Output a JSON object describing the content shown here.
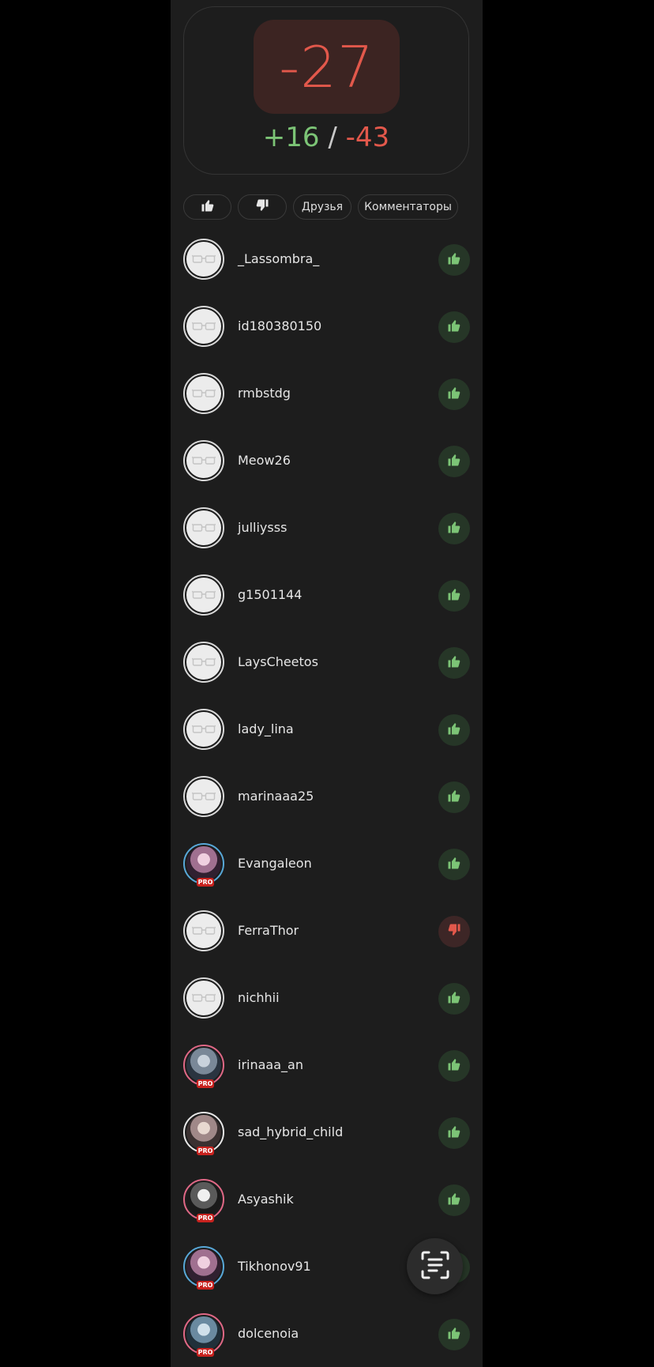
{
  "score": {
    "total": "-27",
    "plus": "+16",
    "separator": " / ",
    "minus": "-43"
  },
  "filters": {
    "likes_icon": "thumb-up-icon",
    "dislikes_icon": "thumb-down-icon",
    "friends": "Друзья",
    "commenters": "Комментаторы"
  },
  "colors": {
    "positive": "#7cc476",
    "negative": "#e2584b",
    "pro_badge": "#c8221e"
  },
  "voters": [
    {
      "username": "_Lassombra_",
      "vote": "up",
      "avatar": "default"
    },
    {
      "username": "id180380150",
      "vote": "up",
      "avatar": "default"
    },
    {
      "username": "rmbstdg",
      "vote": "up",
      "avatar": "default"
    },
    {
      "username": "Meow26",
      "vote": "up",
      "avatar": "default"
    },
    {
      "username": "julliysss",
      "vote": "up",
      "avatar": "default"
    },
    {
      "username": "g1501144",
      "vote": "up",
      "avatar": "default"
    },
    {
      "username": "LaysCheetos",
      "vote": "up",
      "avatar": "default"
    },
    {
      "username": "lady_lina",
      "vote": "up",
      "avatar": "default"
    },
    {
      "username": "marinaaa25",
      "vote": "up",
      "avatar": "default"
    },
    {
      "username": "Evangaleon",
      "vote": "up",
      "avatar": "photo",
      "pro": "PRO",
      "ring": "blue"
    },
    {
      "username": "FerraThor",
      "vote": "down",
      "avatar": "default"
    },
    {
      "username": "nichhii",
      "vote": "up",
      "avatar": "default"
    },
    {
      "username": "irinaaa_an",
      "vote": "up",
      "avatar": "photo",
      "pro": "PRO",
      "ring": "pink"
    },
    {
      "username": "sad_hybrid_child",
      "vote": "up",
      "avatar": "photo",
      "pro": "PRO",
      "ring": "white"
    },
    {
      "username": "Asyashik",
      "vote": "up",
      "avatar": "photo",
      "pro": "PRO",
      "ring": "pink"
    },
    {
      "username": "Tikhonov91",
      "vote": "up",
      "avatar": "photo",
      "pro": "PRO",
      "ring": "blue"
    },
    {
      "username": "dolcenoia",
      "vote": "up",
      "avatar": "photo",
      "pro": "PRO",
      "ring": "pink"
    }
  ],
  "fab": {
    "icon": "text-scan-icon"
  }
}
